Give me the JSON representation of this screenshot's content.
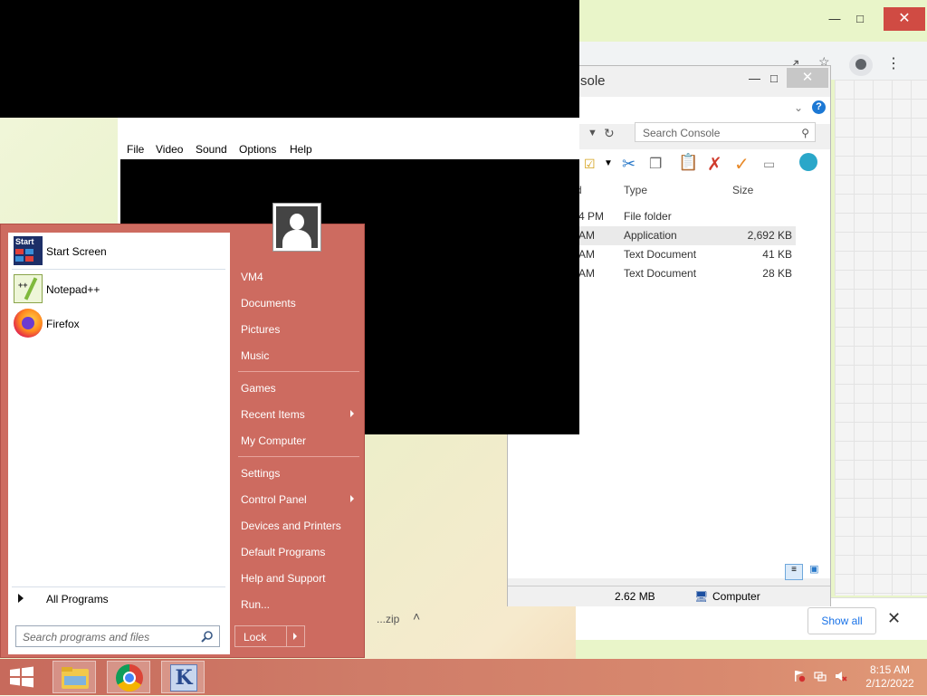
{
  "chrome": {
    "min_icon": "minimize-icon",
    "max_icon": "maximize-icon",
    "close_icon": "close-icon",
    "download_bar": {
      "filename": "...zip",
      "show_all": "Show all"
    }
  },
  "explorer": {
    "title": "sole",
    "search_placeholder": "Search Console",
    "columns": [
      "d",
      "Type",
      "Size"
    ],
    "rows": [
      {
        "date": "4 PM",
        "type": "File folder",
        "size": ""
      },
      {
        "date": "AM",
        "type": "Application",
        "size": "2,692 KB"
      },
      {
        "date": "AM",
        "type": "Text Document",
        "size": "41 KB"
      },
      {
        "date": "AM",
        "type": "Text Document",
        "size": "28 KB"
      }
    ],
    "status_size": "2.62 MB",
    "status_location": "Computer"
  },
  "vm": {
    "menu": [
      "File",
      "Video",
      "Sound",
      "Options",
      "Help"
    ]
  },
  "start_menu": {
    "pinned": [
      {
        "label": "Start Screen",
        "icon": "start-screen-icon"
      },
      {
        "label": "Notepad++",
        "icon": "notepadpp-icon"
      },
      {
        "label": "Firefox",
        "icon": "firefox-icon"
      }
    ],
    "all_programs": "All Programs",
    "search_placeholder": "Search programs and files",
    "right_items": [
      "VM4",
      "Documents",
      "Pictures",
      "Music",
      "Games",
      "Recent Items",
      "My Computer",
      "Settings",
      "Control Panel",
      "Devices and Printers",
      "Default Programs",
      "Help and Support",
      "Run..."
    ],
    "lock": "Lock"
  },
  "taskbar": {
    "time": "8:15 AM",
    "date": "2/12/2022",
    "apps": [
      "windows-start-icon",
      "file-explorer-icon",
      "chrome-icon",
      "k-app-icon"
    ]
  }
}
